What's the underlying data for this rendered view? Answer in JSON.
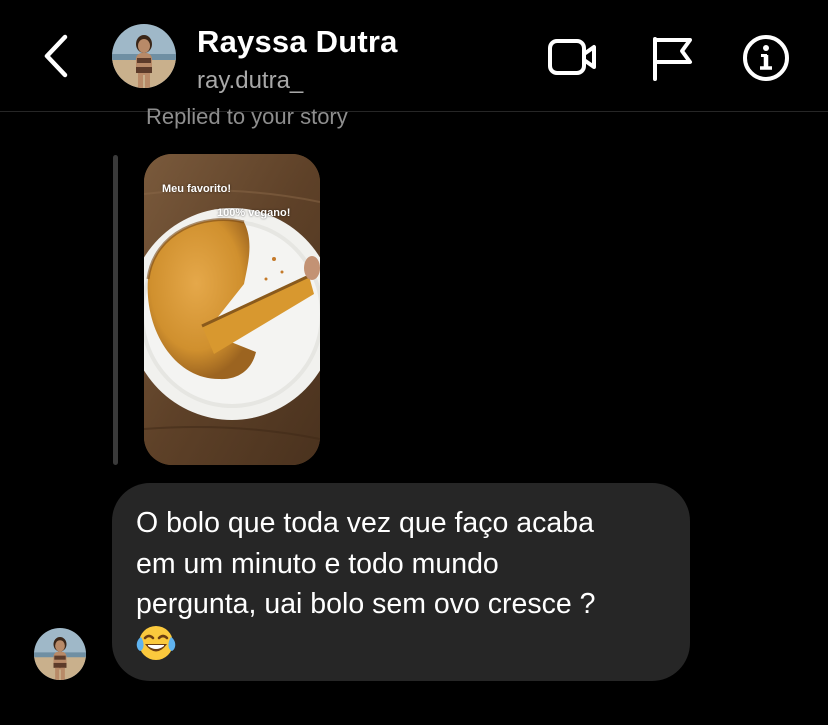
{
  "header": {
    "name": "Rayssa Dutra",
    "username": "ray.dutra_",
    "icons": [
      "chevron-left-icon",
      "video-camera-icon",
      "flag-icon",
      "info-icon"
    ]
  },
  "story_reply": {
    "label": "Replied to your story",
    "story_text_1": "Meu favorito!",
    "story_text_2": "100% vegano!"
  },
  "message": {
    "text": "O bolo que toda vez que faço acaba\nem um minuto e todo mundo\npergunta, uai bolo sem ovo cresce ?",
    "emoji": "face-with-tears-of-joy"
  },
  "colors": {
    "background": "#000000",
    "bubble": "#262626",
    "secondary_text": "#a8a8a8"
  }
}
